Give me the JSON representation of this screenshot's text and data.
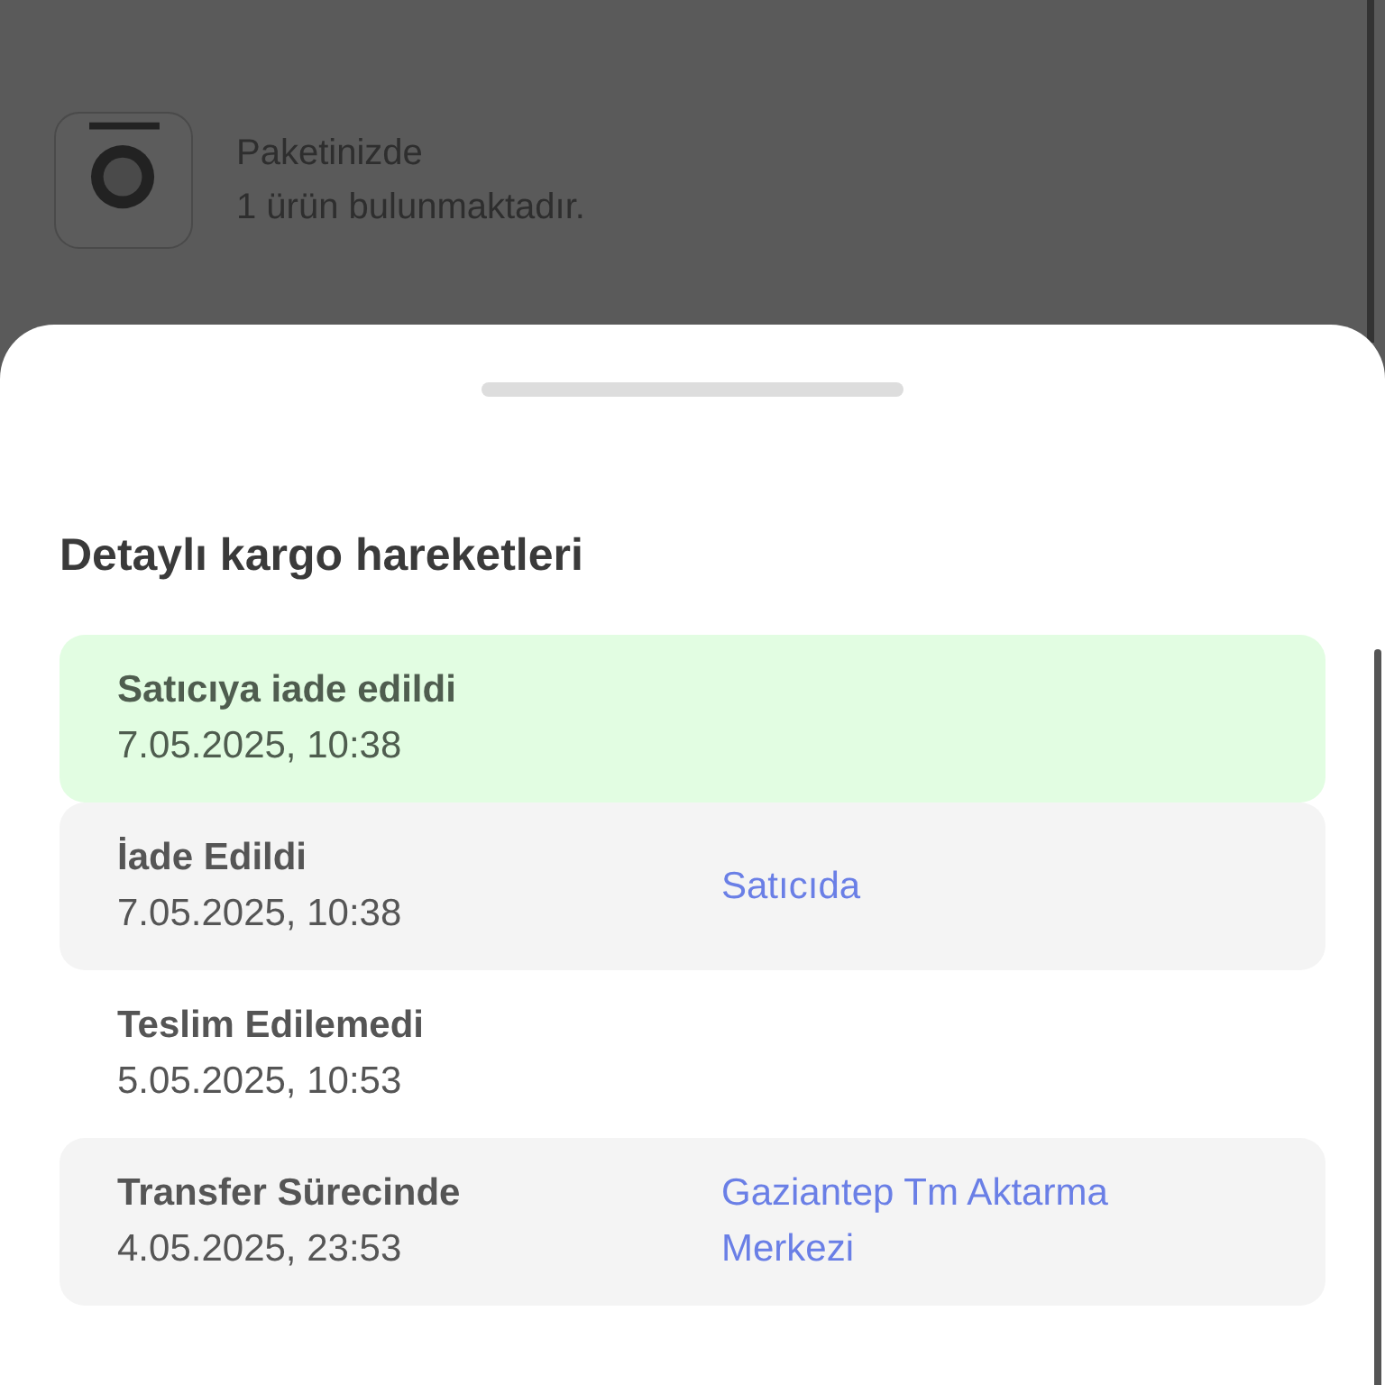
{
  "package": {
    "title": "Paketinizde",
    "subtitle": "1 ürün bulunmaktadır."
  },
  "sheet": {
    "title": "Detaylı kargo hareketleri",
    "events": [
      {
        "status": "Satıcıya iade edildi",
        "time": "7.05.2025, 10:38",
        "kind": "latest"
      },
      {
        "status": "İade Edildi",
        "time": "7.05.2025, 10:38",
        "location": "Satıcıda",
        "kind": "shaded"
      },
      {
        "status": "Teslim Edilemedi",
        "time": "5.05.2025, 10:53",
        "kind": "plain"
      },
      {
        "status": "Transfer Sürecinde",
        "time": "4.05.2025, 23:53",
        "location": "Gaziantep Tm Aktarma Merkezi",
        "kind": "shaded"
      }
    ]
  }
}
